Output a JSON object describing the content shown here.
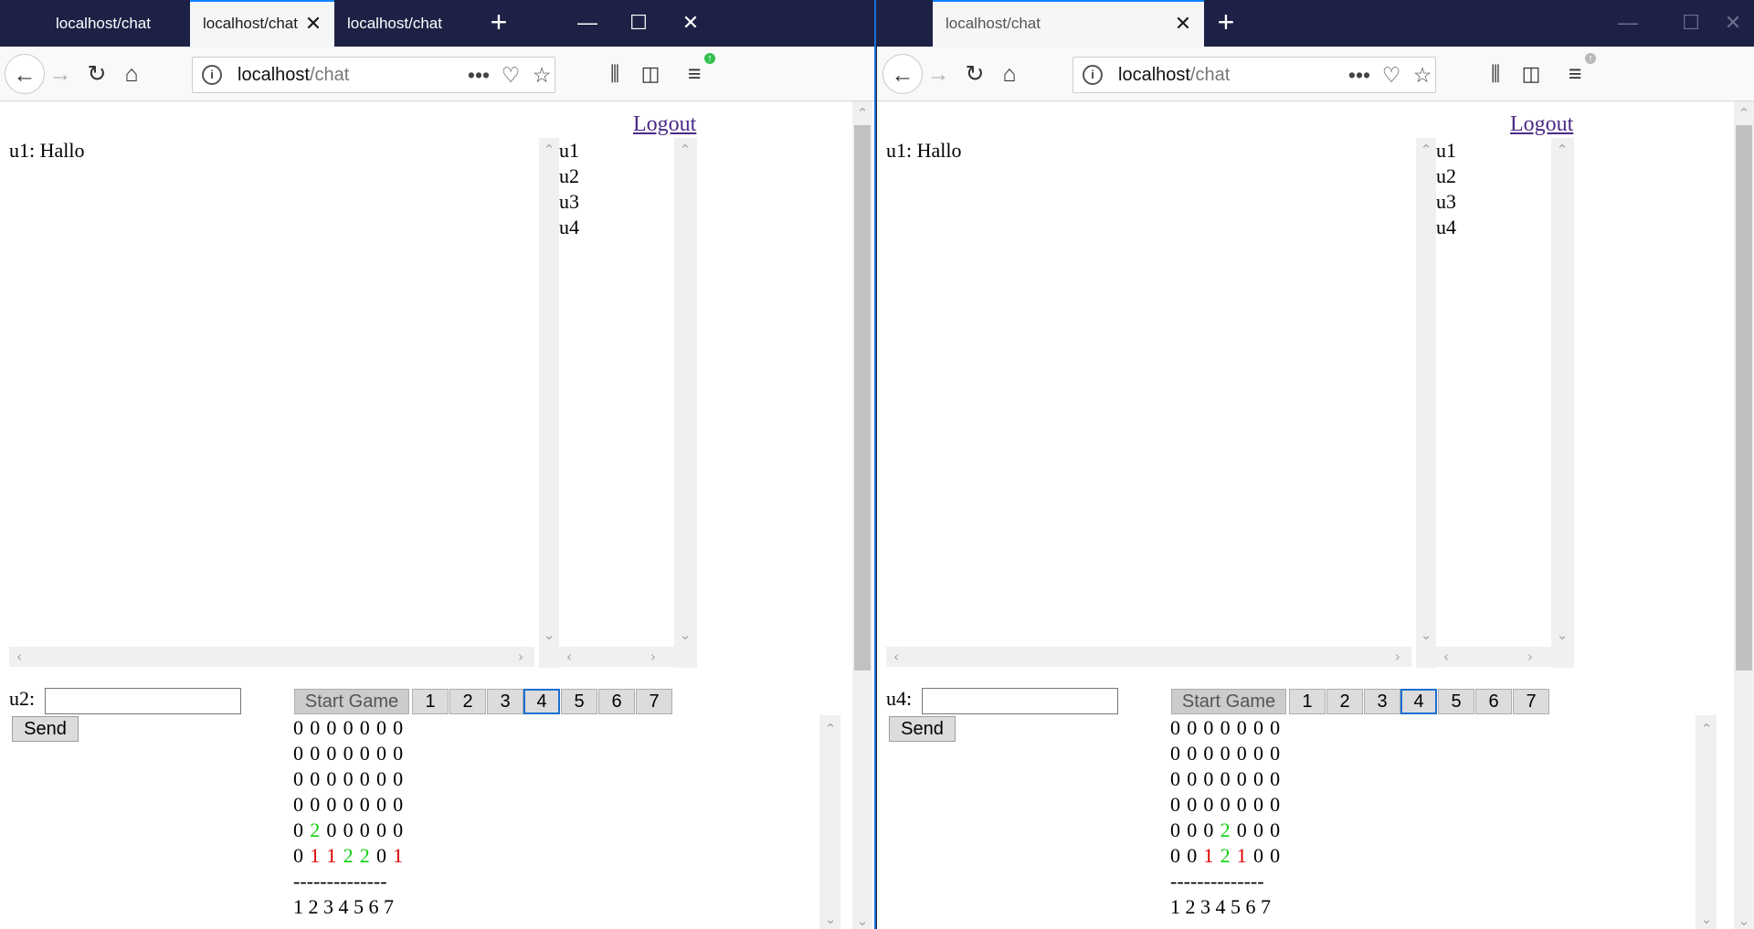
{
  "left_window": {
    "tabs": [
      {
        "title": "localhost/chat",
        "active": false
      },
      {
        "title": "localhost/chat",
        "active": true
      },
      {
        "title": "localhost/chat",
        "active": false
      }
    ],
    "url": {
      "host": "localhost",
      "path": "/chat"
    },
    "logout": "Logout",
    "messages": [
      "u1: Hallo"
    ],
    "users": [
      "u1",
      "u2",
      "u3",
      "u4"
    ],
    "input_label": "u2:",
    "input_value": "",
    "send": "Send",
    "start_game": "Start Game",
    "columns": [
      "1",
      "2",
      "3",
      "4",
      "5",
      "6",
      "7"
    ],
    "selected_column": "4",
    "board": [
      [
        "0",
        "0",
        "0",
        "0",
        "0",
        "0",
        "0"
      ],
      [
        "0",
        "0",
        "0",
        "0",
        "0",
        "0",
        "0"
      ],
      [
        "0",
        "0",
        "0",
        "0",
        "0",
        "0",
        "0"
      ],
      [
        "0",
        "0",
        "0",
        "0",
        "0",
        "0",
        "0"
      ],
      [
        "0",
        "2",
        "0",
        "0",
        "0",
        "0",
        "0"
      ],
      [
        "0",
        "1",
        "1",
        "2",
        "2",
        "0",
        "1"
      ]
    ],
    "separator": "--------------",
    "column_labels": "1 2 3 4 5 6 7"
  },
  "right_window": {
    "tabs": [
      {
        "title": "localhost/chat",
        "active": true
      }
    ],
    "url": {
      "host": "localhost",
      "path": "/chat"
    },
    "logout": "Logout",
    "messages": [
      "u1: Hallo"
    ],
    "users": [
      "u1",
      "u2",
      "u3",
      "u4"
    ],
    "input_label": "u4:",
    "input_value": "",
    "send": "Send",
    "start_game": "Start Game",
    "columns": [
      "1",
      "2",
      "3",
      "4",
      "5",
      "6",
      "7"
    ],
    "selected_column": "4",
    "board": [
      [
        "0",
        "0",
        "0",
        "0",
        "0",
        "0",
        "0"
      ],
      [
        "0",
        "0",
        "0",
        "0",
        "0",
        "0",
        "0"
      ],
      [
        "0",
        "0",
        "0",
        "0",
        "0",
        "0",
        "0"
      ],
      [
        "0",
        "0",
        "0",
        "0",
        "0",
        "0",
        "0"
      ],
      [
        "0",
        "0",
        "0",
        "2",
        "0",
        "0",
        "0"
      ],
      [
        "0",
        "0",
        "1",
        "2",
        "1",
        "0",
        "0"
      ]
    ],
    "separator": "--------------",
    "column_labels": "1 2 3 4 5 6 7"
  },
  "colors": {
    "player1": "#e00000",
    "player2": "#10d010",
    "titlebar": "#1d2145",
    "link": "#4b2a86",
    "focus": "#1b6fd2"
  },
  "icons": {
    "back": "back-arrow-icon",
    "forward": "forward-arrow-icon",
    "reload": "reload-icon",
    "home": "home-icon",
    "info": "site-info-icon",
    "more": "page-actions-icon",
    "pocket": "pocket-icon",
    "bookmark": "star-icon",
    "library": "library-icon",
    "sidebar": "sidebar-icon",
    "menu": "hamburger-menu-icon",
    "new_tab": "plus-icon",
    "close_tab": "close-icon",
    "minimize": "minimize-icon",
    "maximize": "maximize-icon",
    "close_window": "close-icon"
  }
}
